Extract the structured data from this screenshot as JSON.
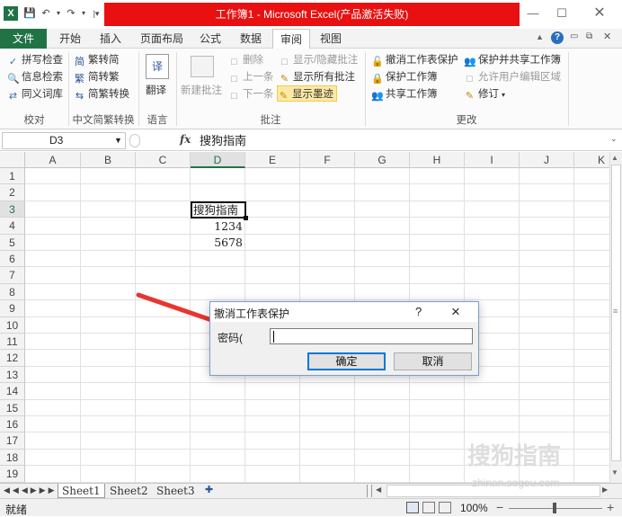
{
  "titlebar": {
    "title": "工作簿1 - Microsoft Excel(产品激活失败)",
    "app_icon": "X",
    "help": "?"
  },
  "tabs": [
    "文件",
    "开始",
    "插入",
    "页面布局",
    "公式",
    "数据",
    "审阅",
    "视图"
  ],
  "ribbon": {
    "proof": {
      "spell": "拼写检查",
      "research": "信息检索",
      "thesaurus": "同义词库",
      "label": "校对"
    },
    "chinese": {
      "to_trad": "繁转简",
      "to_simp": "简转繁",
      "convert": "简繁转换",
      "label": "中文简繁转换"
    },
    "language": {
      "translate": "翻译",
      "label": "语言"
    },
    "comments": {
      "new": "新建批注",
      "delete": "删除",
      "prev": "上一条",
      "next": "下一条",
      "show_hide": "显示/隐藏批注",
      "show_all": "显示所有批注",
      "show_ink": "显示墨迹",
      "label": "批注"
    },
    "changes": {
      "unprotect_sheet": "撤消工作表保护",
      "protect_wb": "保护工作簿",
      "share_wb": "共享工作簿",
      "protect_share": "保护并共享工作簿",
      "allow_edit": "允许用户编辑区域",
      "track": "修订",
      "label": "更改"
    }
  },
  "formula_bar": {
    "name_box": "D3",
    "fx": "fx",
    "content": "搜狗指南"
  },
  "columns": [
    "A",
    "B",
    "C",
    "D",
    "E",
    "F",
    "G",
    "H",
    "I",
    "J",
    "K"
  ],
  "rows": [
    "1",
    "2",
    "3",
    "4",
    "5",
    "6",
    "7",
    "8",
    "9",
    "10",
    "11",
    "12",
    "13",
    "14",
    "15",
    "16",
    "17",
    "18",
    "19"
  ],
  "cells": {
    "d3": "搜狗指南",
    "d4": "1234",
    "d5": "5678"
  },
  "sheets": [
    "Sheet1",
    "Sheet2",
    "Sheet3"
  ],
  "status": {
    "ready": "就绪",
    "zoom": "100%",
    "minus": "−",
    "plus": "+"
  },
  "dialog": {
    "title": "撤消工作表保护",
    "help": "?",
    "close": "×",
    "password_label": "密码(",
    "ok": "确定",
    "cancel": "取消"
  },
  "watermark": {
    "text": "搜狗指南",
    "url": "zhinan.sogou.com"
  },
  "colors": {
    "excel_green": "#217346",
    "title_red": "#e81010",
    "arrow": "#e8352f"
  }
}
